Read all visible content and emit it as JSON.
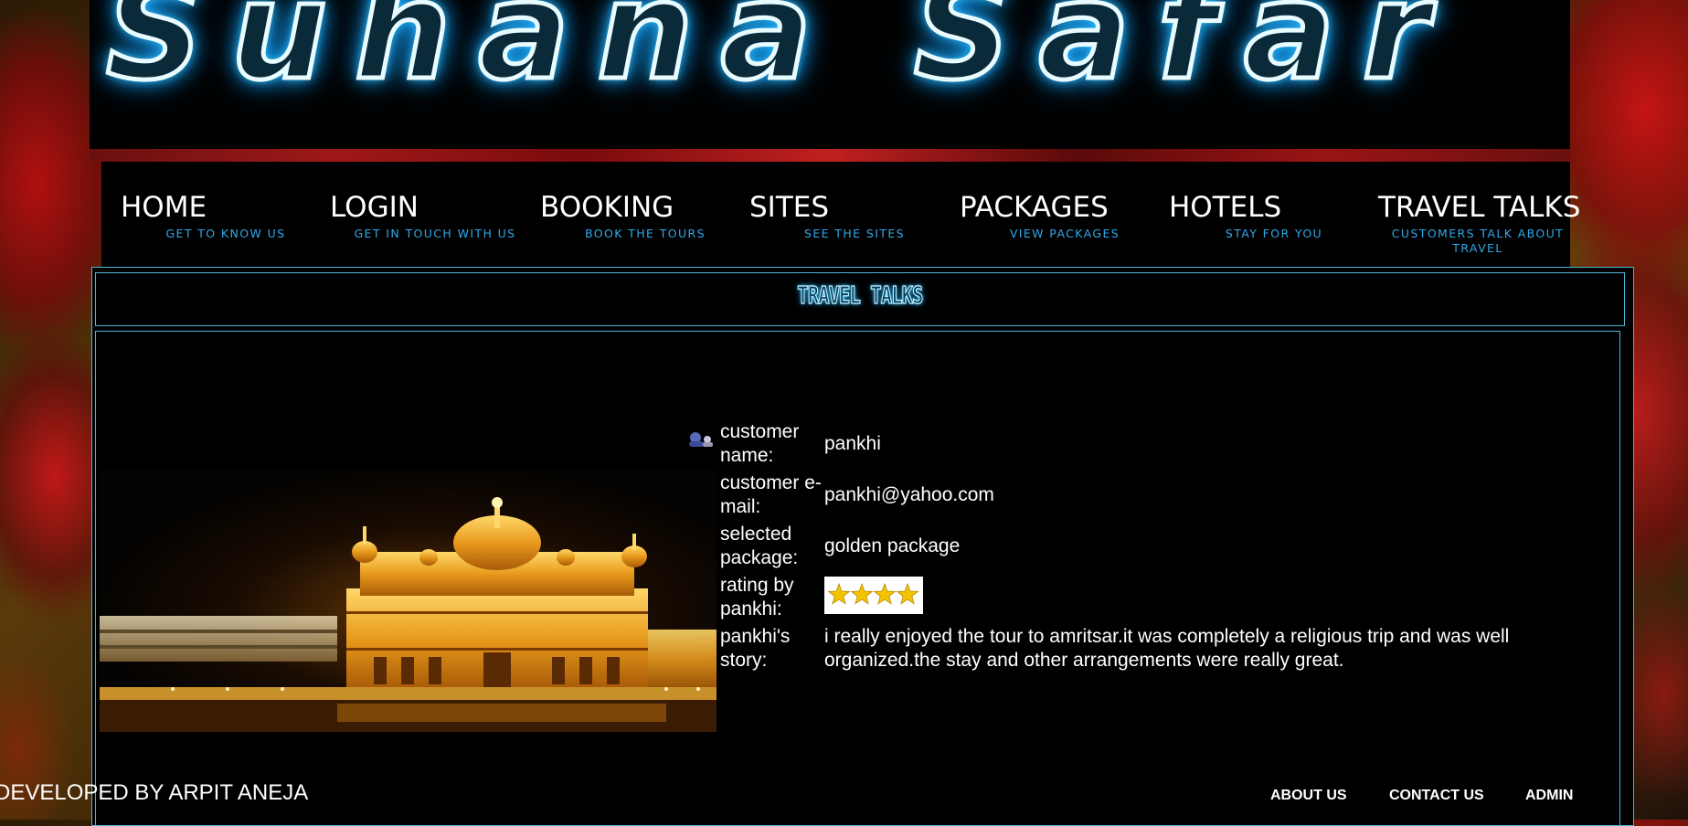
{
  "site": {
    "title": "Suhana Safar"
  },
  "nav": [
    {
      "label": "HOME",
      "sub": "GET TO KNOW US"
    },
    {
      "label": "LOGIN",
      "sub": "GET IN TOUCH WITH US"
    },
    {
      "label": "BOOKING",
      "sub": "BOOK THE TOURS"
    },
    {
      "label": "SITES",
      "sub": "SEE THE SITES"
    },
    {
      "label": "PACKAGES",
      "sub": "VIEW PACKAGES"
    },
    {
      "label": "HOTELS",
      "sub": "STAY FOR YOU"
    },
    {
      "label": "TRAVEL TALKS",
      "sub": "CUSTOMERS TALK ABOUT TRAVEL"
    }
  ],
  "page": {
    "heading": "TRAVEL TALKS"
  },
  "review": {
    "name_label": "customer name:",
    "name": "pankhi",
    "email_label": "customer e-mail:",
    "email": "pankhi@yahoo.com",
    "package_label": "selected package:",
    "package": "golden package",
    "rating_label": "rating by pankhi:",
    "rating_stars": 4,
    "story_label": "pankhi's story:",
    "story": "i really enjoyed the tour to amritsar.it was completely a religious trip and was well organized.the stay and other arrangements were really great."
  },
  "footer": {
    "developer": "DEVELOPED BY ARPIT ANEJA",
    "links": [
      "ABOUT US",
      "CONTACT US",
      "ADMIN"
    ]
  },
  "colors": {
    "accent": "#2fa8e8",
    "border": "#4fb2d6",
    "neon": "#39c8ff"
  }
}
